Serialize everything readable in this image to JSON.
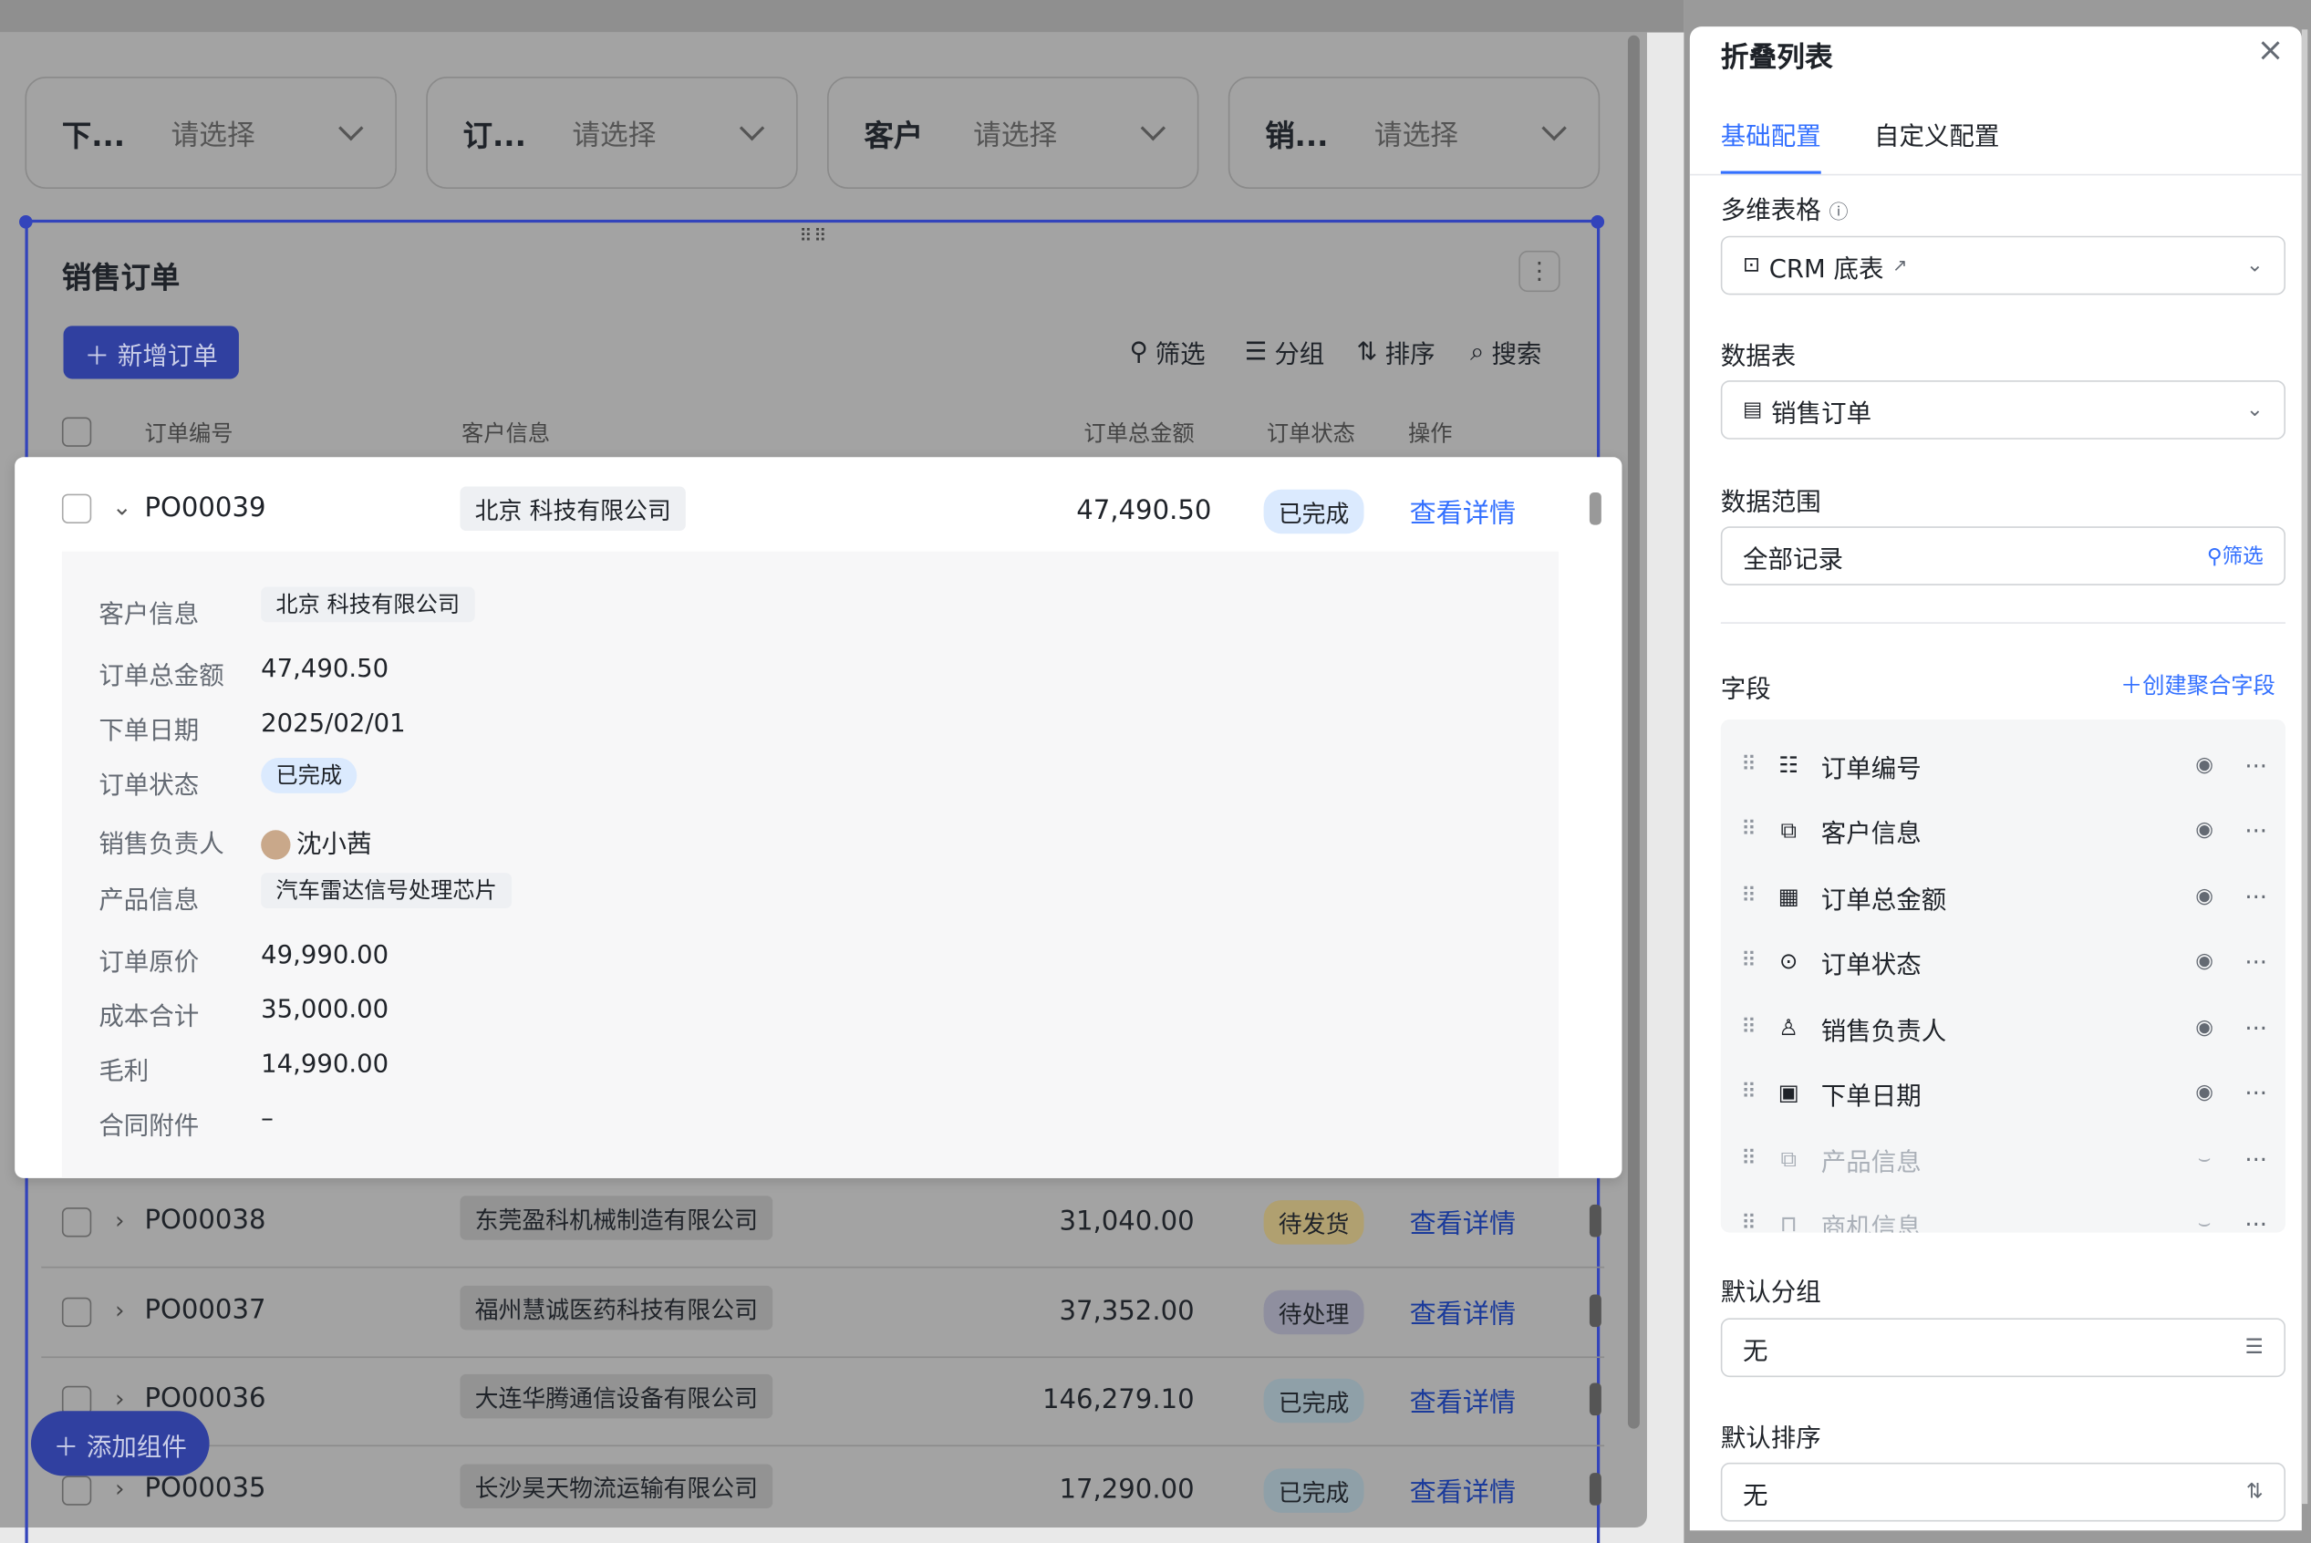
{
  "filters": [
    {
      "label": "下...",
      "placeholder": "请选择"
    },
    {
      "label": "订...",
      "placeholder": "请选择"
    },
    {
      "label": "客户",
      "placeholder": "请选择"
    },
    {
      "label": "销...",
      "placeholder": "请选择"
    }
  ],
  "block": {
    "title": "销售订单",
    "add_button": "＋ 新增订单",
    "tools": {
      "filter": "筛选",
      "group": "分组",
      "sort": "排序",
      "search": "搜索"
    },
    "columns": {
      "id": "订单编号",
      "customer": "客户信息",
      "amount": "订单总金额",
      "status": "订单状态",
      "action": "操作"
    }
  },
  "expanded": {
    "id": "PO00039",
    "customer": "北京 科技有限公司",
    "amount": "47,490.50",
    "status": "已完成",
    "action": "查看详情",
    "fields": [
      {
        "label": "客户信息",
        "value": "北京 科技有限公司"
      },
      {
        "label": "订单总金额",
        "value": "47,490.50"
      },
      {
        "label": "下单日期",
        "value": "2025/02/01"
      },
      {
        "label": "订单状态",
        "value": "已完成"
      },
      {
        "label": "销售负责人",
        "value": "沈小茜"
      },
      {
        "label": "产品信息",
        "value": "汽车雷达信号处理芯片"
      },
      {
        "label": "订单原价",
        "value": "49,990.00"
      },
      {
        "label": "成本合计",
        "value": "35,000.00"
      },
      {
        "label": "毛利",
        "value": "14,990.00"
      },
      {
        "label": "合同附件",
        "value": "–"
      }
    ]
  },
  "rows": [
    {
      "id": "PO00038",
      "customer": "东莞盈科机械制造有限公司",
      "amount": "31,040.00",
      "status": "待发货",
      "action": "查看详情"
    },
    {
      "id": "PO00037",
      "customer": "福州慧诚医药科技有限公司",
      "amount": "37,352.00",
      "status": "待处理",
      "action": "查看详情"
    },
    {
      "id": "PO00036",
      "customer": "大连华腾通信设备有限公司",
      "amount": "146,279.10",
      "status": "已完成",
      "action": "查看详情"
    },
    {
      "id": "PO00035",
      "customer": "长沙昊天物流运输有限公司",
      "amount": "17,290.00",
      "status": "已完成",
      "action": "查看详情"
    }
  ],
  "fab": "＋ 添加组件",
  "panel": {
    "title": "折叠列表",
    "tabs": [
      "基础配置",
      "自定义配置"
    ],
    "table_label": "多维表格",
    "table_value": "CRM 底表",
    "sheet_label": "数据表",
    "sheet_value": "销售订单",
    "range_label": "数据范围",
    "range_value": "全部记录",
    "range_filter": "筛选",
    "fields_label": "字段",
    "create_field": "＋创建聚合字段",
    "fields": [
      "订单编号",
      "客户信息",
      "订单总金额",
      "订单状态",
      "销售负责人",
      "下单日期",
      "产品信息",
      "商机信息"
    ],
    "group_label": "默认分组",
    "group_value": "无",
    "sort_label": "默认排序",
    "sort_value": "无"
  }
}
